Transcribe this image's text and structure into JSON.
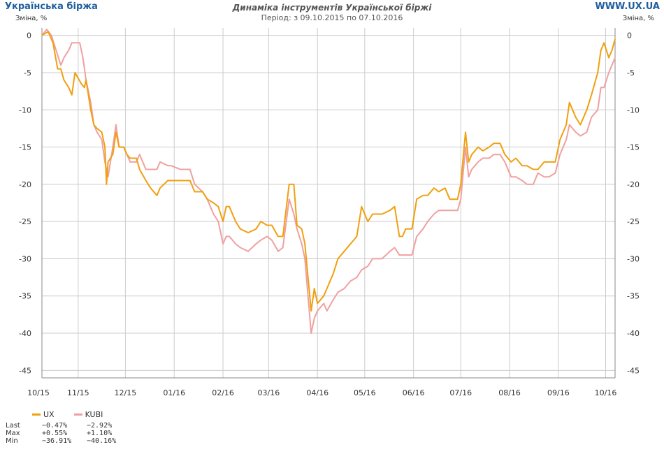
{
  "header": {
    "brand": "Українська біржа",
    "site": "WWW.UX.UA",
    "title": "Динаміка інструментів Української біржі",
    "subtitle": "Період: з 09.10.2015 по 07.10.2016",
    "ylabel_left": "Зміна, %",
    "ylabel_right": "Зміна, %"
  },
  "colors": {
    "UX": "#f0a010",
    "KUBI": "#f0a0a0",
    "grid": "#cccccc",
    "axis": "#888888"
  },
  "chart_data": {
    "type": "line",
    "title": "Динаміка інструментів Української біржі",
    "subtitle": "Період: з 09.10.2015 по 07.10.2016",
    "xlabel": "",
    "ylabel": "Зміна, %",
    "ylim": [
      -46,
      1
    ],
    "yticks": [
      0,
      -5,
      -10,
      -15,
      -20,
      -25,
      -30,
      -35,
      -40,
      -45
    ],
    "xticks": [
      "10/15",
      "11/15",
      "12/15",
      "01/16",
      "02/16",
      "03/16",
      "04/16",
      "05/16",
      "06/16",
      "07/16",
      "08/16",
      "09/16",
      "10/16"
    ],
    "x_range": [
      "2015-10-09",
      "2016-10-07"
    ],
    "grid": true,
    "legend": "bottom-left",
    "series": [
      {
        "name": "UX",
        "points": [
          [
            "2015-10-09",
            0
          ],
          [
            "2015-10-13",
            0.5
          ],
          [
            "2015-10-16",
            -1
          ],
          [
            "2015-10-19",
            -4.5
          ],
          [
            "2015-10-21",
            -4.5
          ],
          [
            "2015-10-23",
            -6
          ],
          [
            "2015-10-26",
            -7
          ],
          [
            "2015-10-28",
            -8
          ],
          [
            "2015-10-30",
            -5
          ],
          [
            "2015-11-03",
            -6.5
          ],
          [
            "2015-11-05",
            -7
          ],
          [
            "2015-11-06",
            -6
          ],
          [
            "2015-11-09",
            -10
          ],
          [
            "2015-11-11",
            -12
          ],
          [
            "2015-11-13",
            -12.5
          ],
          [
            "2015-11-16",
            -13
          ],
          [
            "2015-11-18",
            -15
          ],
          [
            "2015-11-19",
            -20
          ],
          [
            "2015-11-20",
            -17
          ],
          [
            "2015-11-23",
            -16
          ],
          [
            "2015-11-25",
            -13
          ],
          [
            "2015-11-27",
            -15
          ],
          [
            "2015-11-30",
            -15
          ],
          [
            "2015-12-02",
            -16
          ],
          [
            "2015-12-04",
            -16.5
          ],
          [
            "2015-12-08",
            -16.5
          ],
          [
            "2015-12-10",
            -18
          ],
          [
            "2015-12-14",
            -19.5
          ],
          [
            "2015-12-17",
            -20.5
          ],
          [
            "2015-12-21",
            -21.5
          ],
          [
            "2015-12-23",
            -20.5
          ],
          [
            "2015-12-28",
            -19.5
          ],
          [
            "2015-12-30",
            -19.5
          ],
          [
            "2016-01-05",
            -19.5
          ],
          [
            "2016-01-11",
            -19.5
          ],
          [
            "2016-01-14",
            -21
          ],
          [
            "2016-01-19",
            -21
          ],
          [
            "2016-01-22",
            -22
          ],
          [
            "2016-01-26",
            -22.5
          ],
          [
            "2016-01-29",
            -23
          ],
          [
            "2016-02-01",
            -25
          ],
          [
            "2016-02-03",
            -23
          ],
          [
            "2016-02-05",
            -23
          ],
          [
            "2016-02-09",
            -25
          ],
          [
            "2016-02-12",
            -26
          ],
          [
            "2016-02-17",
            -26.5
          ],
          [
            "2016-02-22",
            -26
          ],
          [
            "2016-02-25",
            -25
          ],
          [
            "2016-02-29",
            -25.5
          ],
          [
            "2016-03-03",
            -25.5
          ],
          [
            "2016-03-07",
            -27
          ],
          [
            "2016-03-10",
            -27
          ],
          [
            "2016-03-14",
            -20
          ],
          [
            "2016-03-17",
            -20
          ],
          [
            "2016-03-19",
            -25.5
          ],
          [
            "2016-03-22",
            -26
          ],
          [
            "2016-03-24",
            -28
          ],
          [
            "2016-03-28",
            -37
          ],
          [
            "2016-03-30",
            -34
          ],
          [
            "2016-04-01",
            -36
          ],
          [
            "2016-04-05",
            -35
          ],
          [
            "2016-04-07",
            -34
          ],
          [
            "2016-04-11",
            -32
          ],
          [
            "2016-04-14",
            -30
          ],
          [
            "2016-04-18",
            -29
          ],
          [
            "2016-04-22",
            -28
          ],
          [
            "2016-04-26",
            -27
          ],
          [
            "2016-04-29",
            -23
          ],
          [
            "2016-05-03",
            -25
          ],
          [
            "2016-05-06",
            -24
          ],
          [
            "2016-05-12",
            -24
          ],
          [
            "2016-05-17",
            -23.5
          ],
          [
            "2016-05-20",
            -23
          ],
          [
            "2016-05-23",
            -27
          ],
          [
            "2016-05-25",
            -27
          ],
          [
            "2016-05-27",
            -26
          ],
          [
            "2016-05-31",
            -26
          ],
          [
            "2016-06-03",
            -22
          ],
          [
            "2016-06-07",
            -21.5
          ],
          [
            "2016-06-10",
            -21.5
          ],
          [
            "2016-06-14",
            -20.5
          ],
          [
            "2016-06-17",
            -21
          ],
          [
            "2016-06-21",
            -20.5
          ],
          [
            "2016-06-24",
            -22
          ],
          [
            "2016-06-29",
            -22
          ],
          [
            "2016-07-01",
            -20
          ],
          [
            "2016-07-04",
            -13
          ],
          [
            "2016-07-06",
            -17
          ],
          [
            "2016-07-08",
            -16
          ],
          [
            "2016-07-12",
            -15
          ],
          [
            "2016-07-15",
            -15.5
          ],
          [
            "2016-07-19",
            -15
          ],
          [
            "2016-07-22",
            -14.5
          ],
          [
            "2016-07-26",
            -14.5
          ],
          [
            "2016-07-29",
            -16
          ],
          [
            "2016-08-02",
            -17
          ],
          [
            "2016-08-05",
            -16.5
          ],
          [
            "2016-08-09",
            -17.5
          ],
          [
            "2016-08-12",
            -17.5
          ],
          [
            "2016-08-16",
            -18
          ],
          [
            "2016-08-19",
            -18
          ],
          [
            "2016-08-23",
            -17
          ],
          [
            "2016-08-26",
            -17
          ],
          [
            "2016-08-30",
            -17
          ],
          [
            "2016-09-02",
            -14
          ],
          [
            "2016-09-06",
            -12
          ],
          [
            "2016-09-08",
            -9
          ],
          [
            "2016-09-12",
            -11
          ],
          [
            "2016-09-15",
            -12
          ],
          [
            "2016-09-19",
            -10
          ],
          [
            "2016-09-22",
            -8
          ],
          [
            "2016-09-26",
            -5
          ],
          [
            "2016-09-28",
            -2
          ],
          [
            "2016-09-30",
            -1
          ],
          [
            "2016-10-03",
            -3
          ],
          [
            "2016-10-05",
            -2
          ],
          [
            "2016-10-07",
            -0.5
          ]
        ]
      },
      {
        "name": "KUBI",
        "points": [
          [
            "2015-10-09",
            0
          ],
          [
            "2015-10-12",
            0.8
          ],
          [
            "2015-10-15",
            0
          ],
          [
            "2015-10-18",
            -2
          ],
          [
            "2015-10-21",
            -4
          ],
          [
            "2015-10-23",
            -3
          ],
          [
            "2015-10-26",
            -2
          ],
          [
            "2015-10-28",
            -1
          ],
          [
            "2015-10-30",
            -1
          ],
          [
            "2015-11-02",
            -1
          ],
          [
            "2015-11-04",
            -3
          ],
          [
            "2015-11-06",
            -6
          ],
          [
            "2015-11-09",
            -9
          ],
          [
            "2015-11-11",
            -12
          ],
          [
            "2015-11-13",
            -13
          ],
          [
            "2015-11-16",
            -14
          ],
          [
            "2015-11-18",
            -17
          ],
          [
            "2015-11-20",
            -19
          ],
          [
            "2015-11-23",
            -15
          ],
          [
            "2015-11-25",
            -12
          ],
          [
            "2015-11-27",
            -15
          ],
          [
            "2015-11-30",
            -15
          ],
          [
            "2015-12-02",
            -16
          ],
          [
            "2015-12-04",
            -17
          ],
          [
            "2015-12-08",
            -17
          ],
          [
            "2015-12-10",
            -16
          ],
          [
            "2015-12-14",
            -18
          ],
          [
            "2015-12-17",
            -18
          ],
          [
            "2015-12-21",
            -18
          ],
          [
            "2015-12-23",
            -17
          ],
          [
            "2015-12-28",
            -17.5
          ],
          [
            "2015-12-30",
            -17.5
          ],
          [
            "2016-01-05",
            -18
          ],
          [
            "2016-01-11",
            -18
          ],
          [
            "2016-01-14",
            -20
          ],
          [
            "2016-01-19",
            -21
          ],
          [
            "2016-01-22",
            -22
          ],
          [
            "2016-01-26",
            -24
          ],
          [
            "2016-01-29",
            -25
          ],
          [
            "2016-02-01",
            -28
          ],
          [
            "2016-02-03",
            -27
          ],
          [
            "2016-02-05",
            -27
          ],
          [
            "2016-02-09",
            -28
          ],
          [
            "2016-02-12",
            -28.5
          ],
          [
            "2016-02-17",
            -29
          ],
          [
            "2016-02-22",
            -28
          ],
          [
            "2016-02-25",
            -27.5
          ],
          [
            "2016-02-29",
            -27
          ],
          [
            "2016-03-03",
            -27.5
          ],
          [
            "2016-03-07",
            -29
          ],
          [
            "2016-03-10",
            -28.5
          ],
          [
            "2016-03-14",
            -22
          ],
          [
            "2016-03-17",
            -24
          ],
          [
            "2016-03-19",
            -26
          ],
          [
            "2016-03-22",
            -28
          ],
          [
            "2016-03-24",
            -30
          ],
          [
            "2016-03-28",
            -40
          ],
          [
            "2016-03-30",
            -38
          ],
          [
            "2016-04-01",
            -37
          ],
          [
            "2016-04-05",
            -36
          ],
          [
            "2016-04-07",
            -37
          ],
          [
            "2016-04-11",
            -35.5
          ],
          [
            "2016-04-14",
            -34.5
          ],
          [
            "2016-04-18",
            -34
          ],
          [
            "2016-04-22",
            -33
          ],
          [
            "2016-04-26",
            -32.5
          ],
          [
            "2016-04-29",
            -31.5
          ],
          [
            "2016-05-03",
            -31
          ],
          [
            "2016-05-06",
            -30
          ],
          [
            "2016-05-12",
            -30
          ],
          [
            "2016-05-17",
            -29
          ],
          [
            "2016-05-20",
            -28.5
          ],
          [
            "2016-05-23",
            -29.5
          ],
          [
            "2016-05-25",
            -29.5
          ],
          [
            "2016-05-27",
            -29.5
          ],
          [
            "2016-05-31",
            -29.5
          ],
          [
            "2016-06-03",
            -27
          ],
          [
            "2016-06-07",
            -26
          ],
          [
            "2016-06-10",
            -25
          ],
          [
            "2016-06-14",
            -24
          ],
          [
            "2016-06-17",
            -23.5
          ],
          [
            "2016-06-21",
            -23.5
          ],
          [
            "2016-06-24",
            -23.5
          ],
          [
            "2016-06-29",
            -23.5
          ],
          [
            "2016-07-01",
            -22
          ],
          [
            "2016-07-04",
            -15
          ],
          [
            "2016-07-06",
            -19
          ],
          [
            "2016-07-08",
            -18
          ],
          [
            "2016-07-12",
            -17
          ],
          [
            "2016-07-15",
            -16.5
          ],
          [
            "2016-07-19",
            -16.5
          ],
          [
            "2016-07-22",
            -16
          ],
          [
            "2016-07-26",
            -16
          ],
          [
            "2016-07-29",
            -17
          ],
          [
            "2016-08-02",
            -19
          ],
          [
            "2016-08-05",
            -19
          ],
          [
            "2016-08-09",
            -19.5
          ],
          [
            "2016-08-12",
            -20
          ],
          [
            "2016-08-16",
            -20
          ],
          [
            "2016-08-19",
            -18.5
          ],
          [
            "2016-08-23",
            -19
          ],
          [
            "2016-08-26",
            -19
          ],
          [
            "2016-08-30",
            -18.5
          ],
          [
            "2016-09-02",
            -16
          ],
          [
            "2016-09-06",
            -14
          ],
          [
            "2016-09-08",
            -12
          ],
          [
            "2016-09-12",
            -13
          ],
          [
            "2016-09-15",
            -13.5
          ],
          [
            "2016-09-19",
            -13
          ],
          [
            "2016-09-22",
            -11
          ],
          [
            "2016-09-26",
            -10
          ],
          [
            "2016-09-28",
            -7
          ],
          [
            "2016-09-30",
            -7
          ],
          [
            "2016-10-03",
            -5
          ],
          [
            "2016-10-05",
            -4
          ],
          [
            "2016-10-07",
            -3
          ]
        ]
      }
    ]
  },
  "legend": [
    {
      "name": "UX",
      "color": "#f0a010"
    },
    {
      "name": "KUBI",
      "color": "#f0a0a0"
    }
  ],
  "stats": {
    "last_label": "Last",
    "max_label": "Max",
    "min_label": "Min",
    "ux_last": "−0.47%",
    "kubi_last": "−2.92%",
    "ux_max": "+0.55%",
    "kubi_max": "+1.10%",
    "ux_min": "−36.91%",
    "kubi_min": "−40.16%"
  }
}
